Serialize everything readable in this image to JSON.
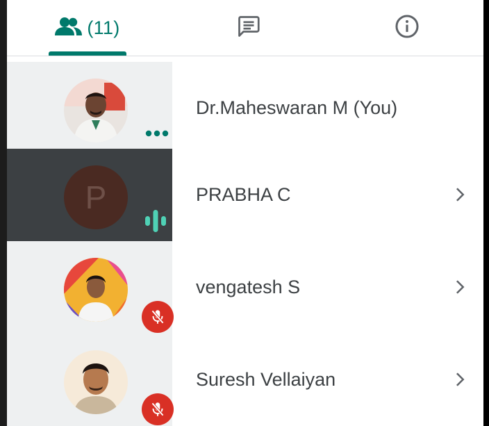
{
  "tabs": {
    "people": {
      "icon": "people-icon",
      "count_label": "(11)"
    },
    "chat": {
      "icon": "chat-icon"
    },
    "info": {
      "icon": "info-icon"
    }
  },
  "participants": [
    {
      "name": "Dr.Maheswaran M (You)",
      "avatar": "photo",
      "status": "more-dots",
      "chevron": false,
      "active": false
    },
    {
      "name": "PRABHA C",
      "avatar_letter": "P",
      "status": "speaking",
      "chevron": true,
      "active": true
    },
    {
      "name": "vengatesh S",
      "avatar": "photo",
      "status": "muted",
      "chevron": true,
      "active": false
    },
    {
      "name": "Suresh Vellaiyan",
      "avatar": "photo",
      "status": "muted",
      "chevron": true,
      "active": false
    }
  ],
  "colors": {
    "accent": "#00796b",
    "speaking": "#4fd1b5",
    "muted": "#d93025",
    "active_row": "#3c4043",
    "avatar_col": "#eef0f1"
  }
}
